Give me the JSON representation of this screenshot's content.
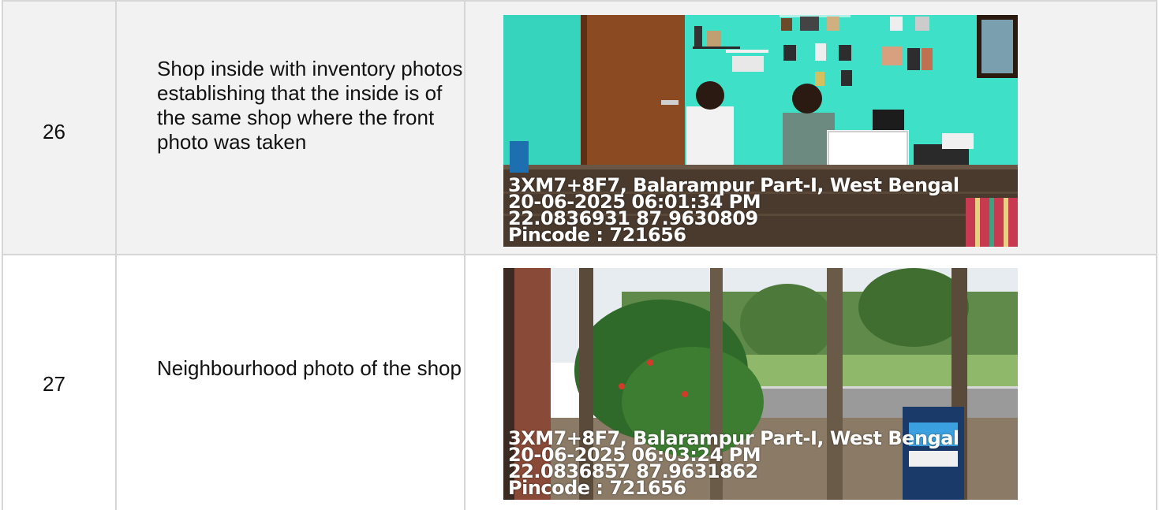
{
  "rows": [
    {
      "number": "26",
      "description": "Shop inside with inventory photos establishing that the inside is of the same shop where the front photo was taken",
      "photo": {
        "scene": "shop-interior",
        "stamp": {
          "location": "3XM7+8F7, Balarampur Part-I, West Bengal",
          "datetime": "20-06-2025 06:01:34 PM",
          "coordinates": "22.0836931 87.9630809",
          "pincode": "Pincode : 721656"
        }
      }
    },
    {
      "number": "27",
      "description": "Neighbourhood photo of the shop",
      "photo": {
        "scene": "neighbourhood",
        "stamp": {
          "location": "3XM7+8F7, Balarampur Part-I, West Bengal",
          "datetime": "20-06-2025 06:03:24 PM",
          "coordinates": "22.0836857 87.9631862",
          "pincode": "Pincode : 721656"
        }
      }
    }
  ],
  "colors": {
    "border": "#d6d6d6",
    "row_shaded": "#f2f2f2",
    "wall": "#3fe0c8"
  }
}
